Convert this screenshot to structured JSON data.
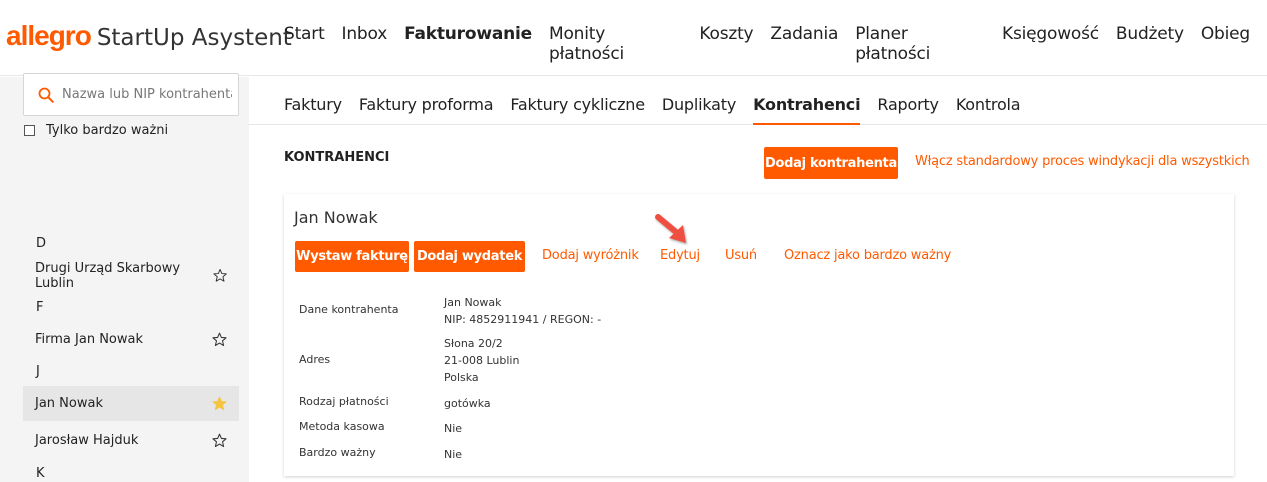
{
  "brand": {
    "name": "allegro",
    "app": "StartUp Asystent"
  },
  "main_nav": [
    {
      "label": "Start",
      "active": false
    },
    {
      "label": "Inbox",
      "active": false
    },
    {
      "label": "Fakturowanie",
      "active": true
    },
    {
      "label": "Monity płatności",
      "active": false
    },
    {
      "label": "Koszty",
      "active": false
    },
    {
      "label": "Zadania",
      "active": false
    },
    {
      "label": "Planer płatności",
      "active": false
    },
    {
      "label": "Księgowość",
      "active": false
    },
    {
      "label": "Budżety",
      "active": false
    },
    {
      "label": "Obieg",
      "active": false
    }
  ],
  "sub_nav": [
    {
      "label": "Faktury",
      "active": false
    },
    {
      "label": "Faktury proforma",
      "active": false
    },
    {
      "label": "Faktury cykliczne",
      "active": false
    },
    {
      "label": "Duplikaty",
      "active": false
    },
    {
      "label": "Kontrahenci",
      "active": true
    },
    {
      "label": "Raporty",
      "active": false
    },
    {
      "label": "Kontrola",
      "active": false
    }
  ],
  "sidebar": {
    "search_placeholder": "Nazwa lub NIP kontrahenta",
    "vip_filter_label": "Tylko bardzo ważni",
    "letters": [
      "D",
      "F",
      "J",
      "K"
    ],
    "contacts": [
      {
        "name": "Drugi Urząd Skarbowy Lublin",
        "starred": false,
        "selected": false
      },
      {
        "name": "Firma Jan Nowak",
        "starred": false,
        "selected": false
      },
      {
        "name": "Jan Nowak",
        "starred": true,
        "selected": true
      },
      {
        "name": "Jarosław Hajduk",
        "starred": false,
        "selected": false
      }
    ]
  },
  "header": {
    "title": "KONTRAHENCI",
    "add_button": "Dodaj kontrahenta",
    "enable_process_link": "Włącz standardowy proces windykacji dla wszystkich"
  },
  "card": {
    "name": "Jan Nowak",
    "issue_invoice": "Wystaw fakturę",
    "add_expense": "Dodaj wydatek",
    "add_highlight": "Dodaj wyróżnik",
    "edit": "Edytuj",
    "delete": "Usuń",
    "mark_vip": "Oznacz jako bardzo ważny",
    "details": {
      "contractor_label": "Dane kontrahenta",
      "contractor_name": "Jan Nowak",
      "contractor_ids": "NIP: 4852911941 / REGON: -",
      "address_label": "Adres",
      "address_line1": "Słona 20/2",
      "address_line2": "21-008 Lublin",
      "address_line3": "Polska",
      "payment_type_label": "Rodzaj płatności",
      "payment_type": "gotówka",
      "cash_method_label": "Metoda kasowa",
      "cash_method": "Nie",
      "vip_label": "Bardzo ważny",
      "vip": "Nie"
    }
  },
  "colors": {
    "accent": "#ff5a00",
    "star_active": "#f4c542",
    "sidebar_bg": "#f4f4f4",
    "arrow": "#ef4f3f"
  }
}
